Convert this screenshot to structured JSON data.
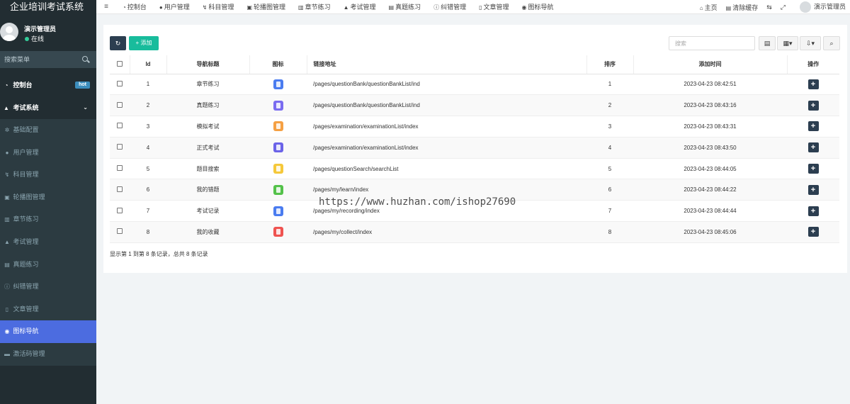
{
  "brand": {
    "title": "企业培训考试系统"
  },
  "user": {
    "name": "演示管理员",
    "status": "在线"
  },
  "sidebar": {
    "search_placeholder": "搜索菜单",
    "dashboard": {
      "label": "控制台",
      "badge": "hot"
    },
    "group": {
      "label": "考试系统"
    },
    "items": [
      {
        "label": "基础配置",
        "icon": "gear-icon"
      },
      {
        "label": "用户管理",
        "icon": "user-icon"
      },
      {
        "label": "科目管理",
        "icon": "subject-icon"
      },
      {
        "label": "轮播图管理",
        "icon": "image-icon"
      },
      {
        "label": "章节练习",
        "icon": "book-icon"
      },
      {
        "label": "考试管理",
        "icon": "graduation-cap-icon"
      },
      {
        "label": "真题练习",
        "icon": "list-icon"
      },
      {
        "label": "纠错管理",
        "icon": "info-icon"
      },
      {
        "label": "文章管理",
        "icon": "file-icon"
      },
      {
        "label": "图标导航",
        "icon": "eye-icon",
        "active": true
      },
      {
        "label": "激活码管理",
        "icon": "card-icon"
      }
    ]
  },
  "topnav": {
    "tabs": [
      {
        "label": "控制台",
        "icon": "dashboard-icon"
      },
      {
        "label": "用户管理",
        "icon": "user-icon"
      },
      {
        "label": "科目管理",
        "icon": "subject-icon"
      },
      {
        "label": "轮播图管理",
        "icon": "image-icon"
      },
      {
        "label": "章节练习",
        "icon": "book-icon"
      },
      {
        "label": "考试管理",
        "icon": "graduation-cap-icon"
      },
      {
        "label": "真题练习",
        "icon": "list-icon"
      },
      {
        "label": "纠错管理",
        "icon": "info-icon"
      },
      {
        "label": "文章管理",
        "icon": "file-icon"
      },
      {
        "label": "图标导航",
        "icon": "eye-icon"
      }
    ],
    "home": "主页",
    "clear_cache": "清除缓存",
    "user_name": "演示管理员"
  },
  "toolbar": {
    "add_label": "添加",
    "search_placeholder": "搜索"
  },
  "table": {
    "headers": {
      "id": "Id",
      "title": "导航标题",
      "icon": "图标",
      "link": "链接地址",
      "sort": "排序",
      "time": "添加时间",
      "op": "操作"
    },
    "rows": [
      {
        "id": "1",
        "title": "章节练习",
        "icon_color": "#4a7cf0",
        "link": "/pages/questionBank/questionBankList/ind",
        "sort": "1",
        "time": "2023-04-23 08:42:51"
      },
      {
        "id": "2",
        "title": "真题练习",
        "icon_color": "#7a6cf0",
        "link": "/pages/questionBank/questionBankList/ind",
        "sort": "2",
        "time": "2023-04-23 08:43:16"
      },
      {
        "id": "3",
        "title": "模拟考试",
        "icon_color": "#f5a043",
        "link": "/pages/examination/examinationList/index",
        "sort": "3",
        "time": "2023-04-23 08:43:31"
      },
      {
        "id": "4",
        "title": "正式考试",
        "icon_color": "#6b63e8",
        "link": "/pages/examination/examinationList/index",
        "sort": "4",
        "time": "2023-04-23 08:43:50"
      },
      {
        "id": "5",
        "title": "题目搜索",
        "icon_color": "#f5c83a",
        "link": "/pages/questionSearch/searchList",
        "sort": "5",
        "time": "2023-04-23 08:44:05"
      },
      {
        "id": "6",
        "title": "我的错题",
        "icon_color": "#54c24a",
        "link": "/pages/my/learn/index",
        "sort": "6",
        "time": "2023-04-23 08:44:22"
      },
      {
        "id": "7",
        "title": "考试记录",
        "icon_color": "#4a7cf0",
        "link": "/pages/my/recording/index",
        "sort": "7",
        "time": "2023-04-23 08:44:44"
      },
      {
        "id": "8",
        "title": "我的收藏",
        "icon_color": "#ef5350",
        "link": "/pages/my/collect/index",
        "sort": "8",
        "time": "2023-04-23 08:45:06"
      }
    ],
    "footer": "显示第 1 到第 8 条记录，总共 8 条记录"
  },
  "watermark": "https://www.huzhan.com/ishop27690"
}
